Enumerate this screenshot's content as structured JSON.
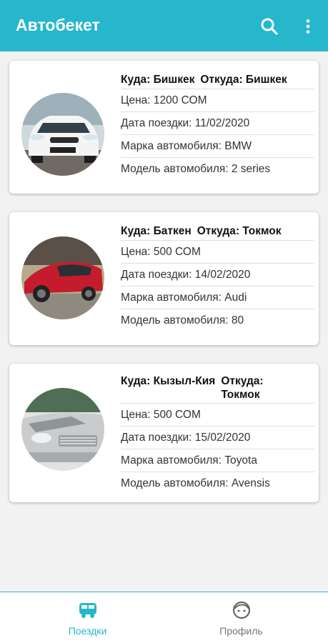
{
  "app": {
    "title": "Автобекет",
    "accent": "#26b7cd"
  },
  "toolbar": {
    "search_icon": "search-icon",
    "more_icon": "more-vert-icon"
  },
  "trips": [
    {
      "to_label": "Куда: Бишкек",
      "from_label": "Откуда: Бишкек",
      "price": "Цена: 1200 СОМ",
      "date": "Дата поездки: 11/02/2020",
      "brand": "Марка автомобиля: BMW",
      "model": "Модель автомобиля: 2 series",
      "car_color": "#f4f4f4"
    },
    {
      "to_label": "Куда: Баткен",
      "from_label": "Откуда: Токмок",
      "price": "Цена: 500 СОМ",
      "date": "Дата поездки: 14/02/2020",
      "brand": "Марка автомобиля: Audi",
      "model": "Модель автомобиля: 80",
      "car_color": "#c41c2c"
    },
    {
      "to_label": "Куда: Кызыл-Кия",
      "from_label": "Откуда: Токмок",
      "price": "Цена: 500 СОМ",
      "date": "Дата поездки: 15/02/2020",
      "brand": "Марка автомобиля: Toyota",
      "model": "Модель автомобиля: Avensis",
      "car_color": "#c9cbcc"
    }
  ],
  "bottom_nav": [
    {
      "label": "Поездки",
      "icon": "bus-icon",
      "active": true
    },
    {
      "label": "Профиль",
      "icon": "face-icon",
      "active": false
    }
  ]
}
